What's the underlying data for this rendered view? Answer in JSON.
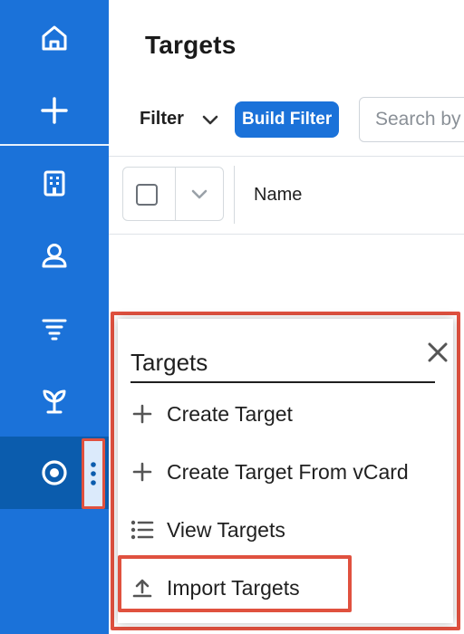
{
  "sidebar": {
    "items": [
      {
        "icon": "home-icon"
      },
      {
        "icon": "plus-icon"
      },
      {
        "icon": "building-icon"
      },
      {
        "icon": "contact-icon"
      },
      {
        "icon": "funnel-icon"
      },
      {
        "icon": "sprout-icon"
      },
      {
        "icon": "target-icon",
        "active": true
      }
    ],
    "accent": "#1b72d9",
    "active_color": "#0b5cad"
  },
  "header": {
    "title": "Targets",
    "filter_label": "Filter",
    "build_filter_label": "Build Filter",
    "search_placeholder": "Search by"
  },
  "table": {
    "columns": [
      "Name"
    ]
  },
  "popup": {
    "title": "Targets",
    "items": [
      {
        "label": "Create Target",
        "icon": "plus-icon"
      },
      {
        "label": "Create Target From vCard",
        "icon": "plus-icon"
      },
      {
        "label": "View Targets",
        "icon": "list-icon"
      },
      {
        "label": "Import Targets",
        "icon": "upload-icon",
        "highlighted": true
      }
    ],
    "highlight_color": "#e0513f"
  }
}
